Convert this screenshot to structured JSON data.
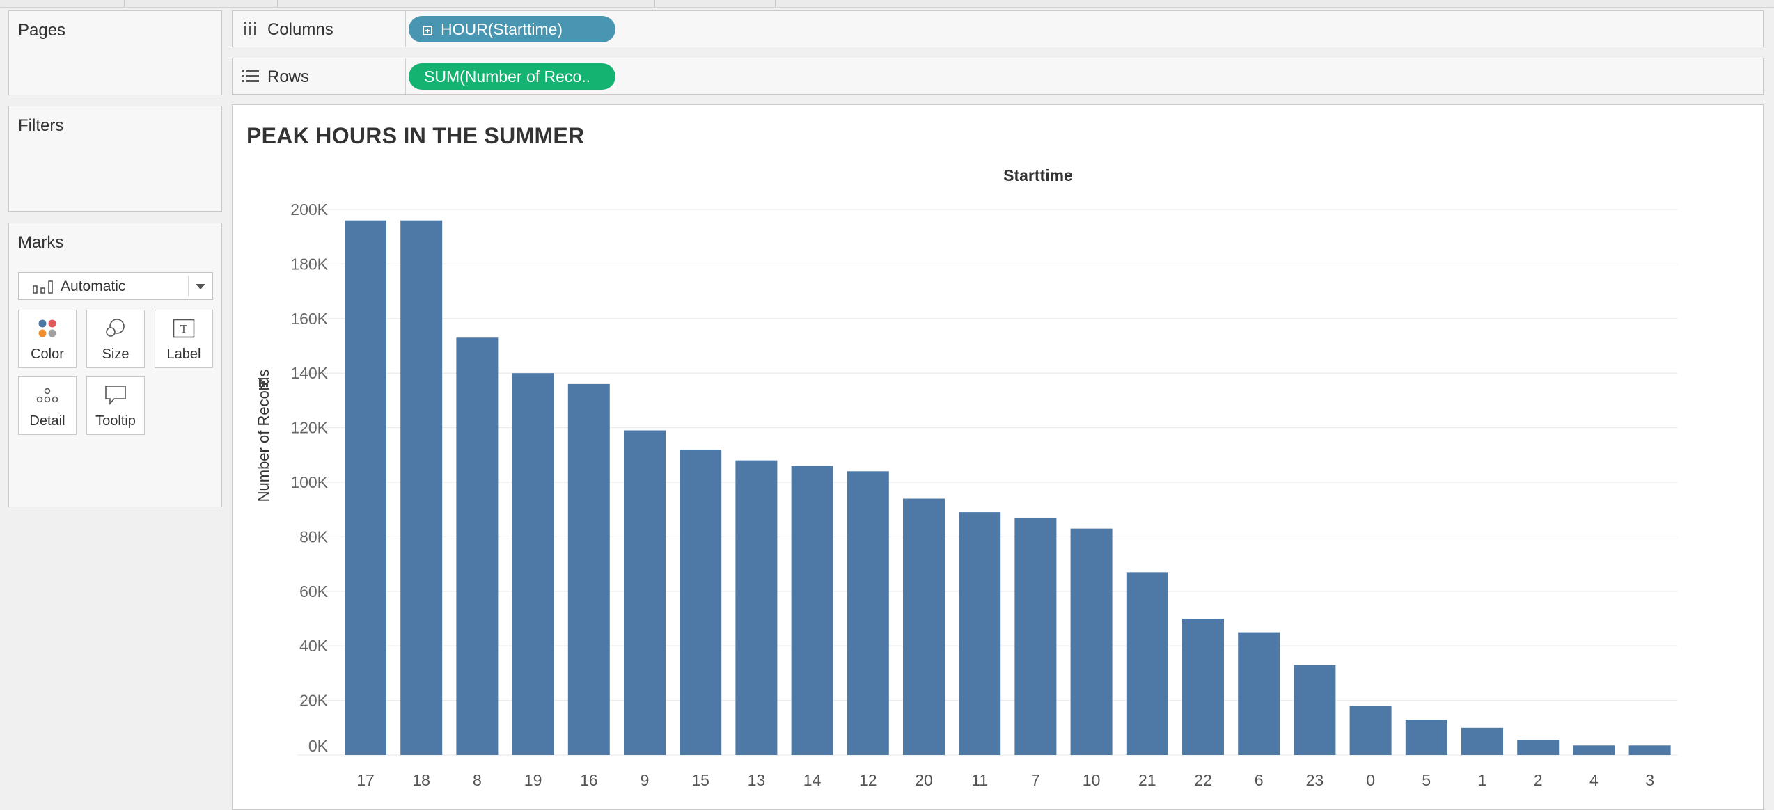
{
  "shelves": {
    "pages_label": "Pages",
    "filters_label": "Filters",
    "columns_label": "Columns",
    "rows_label": "Rows",
    "columns_pill": "HOUR(Starttime)",
    "rows_pill": "SUM(Number of Reco.."
  },
  "marks": {
    "title": "Marks",
    "mark_type": "Automatic",
    "cards": [
      "Color",
      "Size",
      "Label",
      "Detail",
      "Tooltip"
    ]
  },
  "colors": {
    "bar": "#4e79a7",
    "columns_pill": "#4996b2",
    "rows_pill": "#15b371"
  },
  "chart_data": {
    "type": "bar",
    "title": "PEAK HOURS IN THE SUMMER",
    "xlabel": "Starttime",
    "ylabel": "Number of Records",
    "categories": [
      "17",
      "18",
      "8",
      "19",
      "16",
      "9",
      "15",
      "13",
      "14",
      "12",
      "20",
      "11",
      "7",
      "10",
      "21",
      "22",
      "6",
      "23",
      "0",
      "5",
      "1",
      "2",
      "4",
      "3"
    ],
    "values": [
      196000,
      196000,
      153000,
      140000,
      136000,
      119000,
      112000,
      108000,
      106000,
      104000,
      94000,
      89000,
      87000,
      83000,
      67000,
      50000,
      45000,
      33000,
      18000,
      13000,
      10000,
      5500,
      3500,
      3500
    ],
    "ylim": [
      0,
      200000
    ],
    "y_ticks": [
      "0K",
      "20K",
      "40K",
      "60K",
      "80K",
      "100K",
      "120K",
      "140K",
      "160K",
      "180K",
      "200K"
    ],
    "grid": true
  }
}
